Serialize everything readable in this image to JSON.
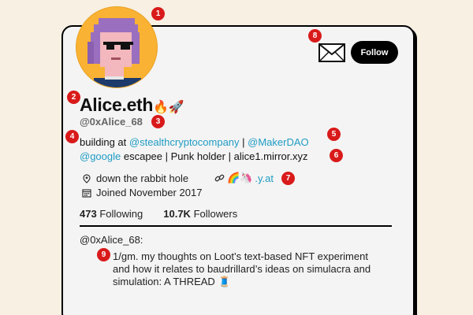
{
  "profile": {
    "display_name": "Alice.eth",
    "display_name_emoji": "🔥🚀",
    "handle": "@0xAlice_68",
    "bio": {
      "line1_prefix": "building at ",
      "link_company": "@stealthcryptocompany",
      "separator1": " | ",
      "link_maker": "@MakerDAO",
      "link_google": "@google",
      "line2_rest": " escapee | Punk holder | alice1.mirror.xyz"
    },
    "location": "down the rabbit hole",
    "link_emoji": "🌈🦄",
    "link_text": ".y.at",
    "joined": "Joined November 2017",
    "following_count": "473",
    "following_label": "Following",
    "followers_count": "10.7K",
    "followers_label": "Followers"
  },
  "actions": {
    "follow_label": "Follow"
  },
  "tweet": {
    "author": "@0xAlice_68:",
    "text": "1/gm. my thoughts on Loot’s text-based NFT experiment and how it relates to baudrillard’s ideas on simulacra and simulation: A THREAD",
    "emoji": "🧵"
  },
  "badges": [
    "1",
    "2",
    "3",
    "4",
    "5",
    "6",
    "7",
    "8",
    "9"
  ],
  "colors": {
    "background": "#f7f0e3",
    "card": "#f4f4f4",
    "link": "#1f9cc4",
    "badge": "#d91a1a",
    "avatar_bg": "#f9b233"
  },
  "icons": {
    "location": "map-pin-icon",
    "calendar": "calendar-icon",
    "link": "link-icon",
    "message": "envelope-icon"
  }
}
